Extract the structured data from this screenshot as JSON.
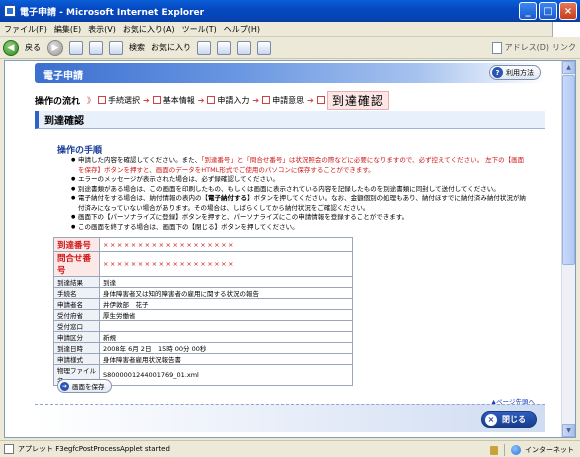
{
  "window": {
    "title": "電子申請 - Microsoft Internet Explorer",
    "minimize": "_",
    "maximize": "□",
    "close": "×"
  },
  "menu": [
    "ファイル(F)",
    "編集(E)",
    "表示(V)",
    "お気に入り(A)",
    "ツール(T)",
    "ヘルプ(H)"
  ],
  "toolbar": {
    "back": "戻る",
    "search": "検索",
    "favorites": "お気に入り",
    "address_label": "アドレス(D)",
    "links_label": "リンク"
  },
  "header": {
    "title": "電子申請",
    "help_label": "利用方法"
  },
  "steps": {
    "flow_label": "操作の流れ",
    "items": [
      "手続選択",
      "基本情報",
      "申請入力",
      "申請意思"
    ],
    "current": "到達確認"
  },
  "section_title": "到達確認",
  "procedure": {
    "title": "操作の手順",
    "items": [
      {
        "pre": "申請した内容を確認してください。また、",
        "red": "「到達番号」と「問合せ番号」は状況照会の際などに必要になりますので、必ず控えてください。 左下の【画面を保存】ボタンを押すと、画面のデータをHTML形式でご使用のパソコンに保存することができます。",
        "post": ""
      },
      {
        "pre": "エラーのメッセージが表示された場合は、必ず録確認してください。",
        "red": "",
        "post": ""
      },
      {
        "pre": "別途書類がある場合は、この画面を印刷したもの、もしくは画面に表示されている内容を記録したものを別途書類に同封して送付してください。",
        "red": "",
        "post": ""
      },
      {
        "pre": "電子納付をする場合は、納付情報の表内の【",
        "red": "電子納付する",
        "post": "】ボタンを押してください。なお、金額個別の処理もあり、納付ほすでに納付済み納付状況が納付済みになっていない場合があります。その場合は、しばらくしてから納付状況をご確認ください。"
      },
      {
        "pre": "画面下の【パーソナライズに登録】ボタンを押すと、パーソナライズにこの申請情報を登録することができます。",
        "red": "",
        "post": ""
      },
      {
        "pre": "この画面を終了する場合は、画面下の【閉じる】ボタンを押してください。",
        "red": "",
        "post": ""
      }
    ]
  },
  "info": {
    "arrival_no_label": "到達番号",
    "arrival_no_value": "×××××××××××××××××××",
    "inquiry_no_label": "問合せ番号",
    "inquiry_no_value": "×××××××××××××××××××",
    "rows": [
      {
        "k": "到達結果",
        "v": "到達"
      },
      {
        "k": "手続名",
        "v": "身体障害者又は知的障害者の雇用に関する状況の報告"
      },
      {
        "k": "申請者名",
        "v": "井伊敦部　花子"
      },
      {
        "k": "受付府省",
        "v": "厚生労働省"
      },
      {
        "k": "受付窓口",
        "v": ""
      },
      {
        "k": "申請区分",
        "v": "新規"
      },
      {
        "k": "到達日時",
        "v": "2008年 6月 2日　15時 00分 00秒"
      },
      {
        "k": "申請様式",
        "v": "身体障害者雇用状況報告書"
      },
      {
        "k": "物理ファイル名",
        "v": "S8000001244001769_01.xml"
      }
    ]
  },
  "buttons": {
    "save": "画面を保存",
    "to_top": "▲ページ先頭へ",
    "close": "閉じる"
  },
  "status": {
    "text": "アプレット F3egfcPostProcessApplet started",
    "zone": "インターネット"
  }
}
